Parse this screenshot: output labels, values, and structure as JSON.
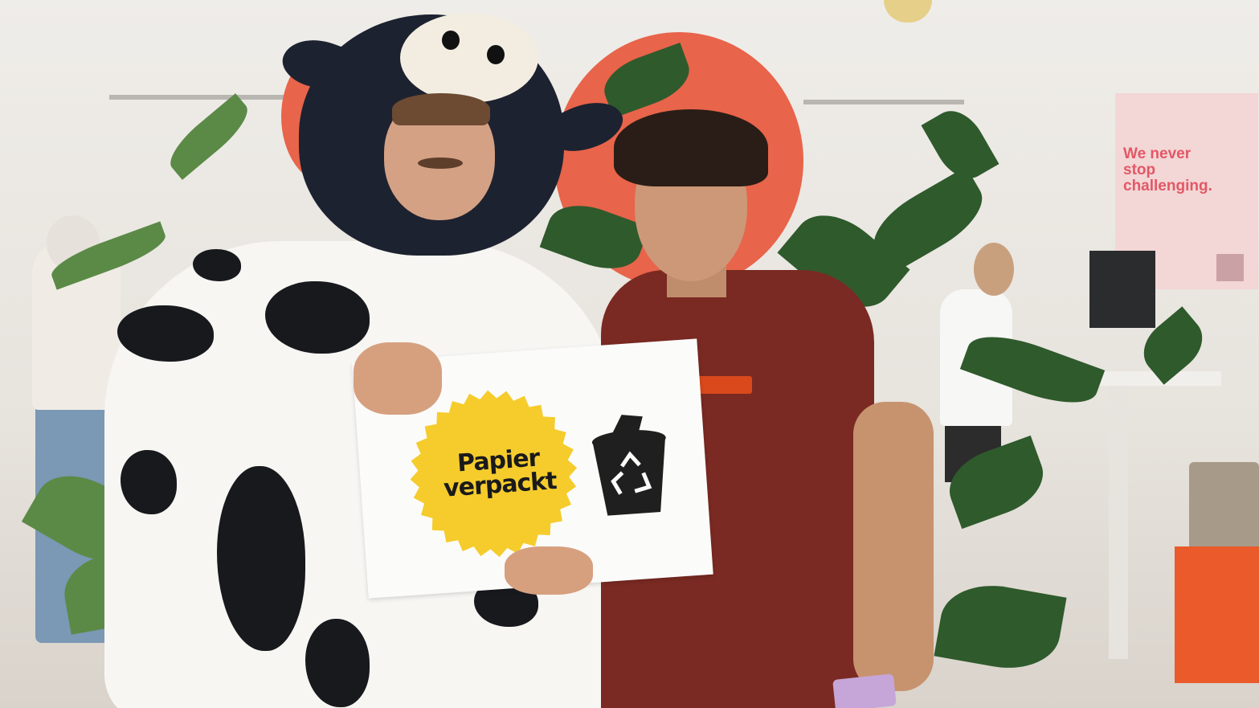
{
  "sign": {
    "text_line1": "Papier",
    "text_line2": "verpackt",
    "badge_color": "#f5cc2c",
    "icon": "recycle-bin-icon"
  },
  "poster": {
    "line1": "We never",
    "line2": "stop",
    "line3": "challenging.",
    "color": "#e25866"
  },
  "colors": {
    "wall_disc": "#e8644a",
    "shirt": "#7a2a22",
    "cow_dark": "#1d2230"
  }
}
